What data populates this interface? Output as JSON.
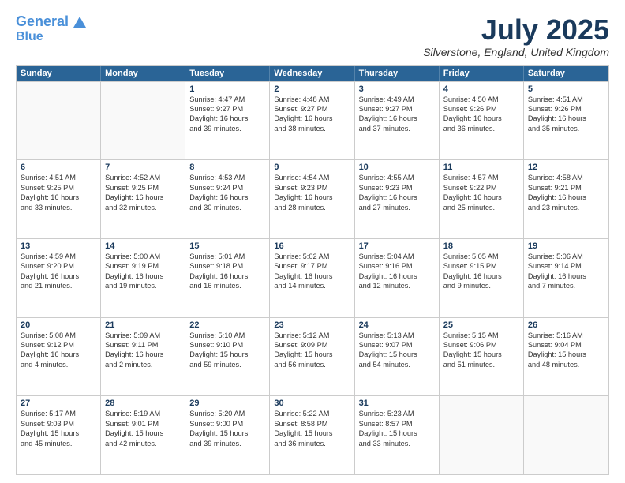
{
  "logo": {
    "line1": "General",
    "line2": "Blue"
  },
  "title": "July 2025",
  "location": "Silverstone, England, United Kingdom",
  "header_days": [
    "Sunday",
    "Monday",
    "Tuesday",
    "Wednesday",
    "Thursday",
    "Friday",
    "Saturday"
  ],
  "weeks": [
    [
      {
        "day": "",
        "sunrise": "",
        "sunset": "",
        "daylight": ""
      },
      {
        "day": "",
        "sunrise": "",
        "sunset": "",
        "daylight": ""
      },
      {
        "day": "1",
        "sunrise": "Sunrise: 4:47 AM",
        "sunset": "Sunset: 9:27 PM",
        "daylight": "Daylight: 16 hours and 39 minutes."
      },
      {
        "day": "2",
        "sunrise": "Sunrise: 4:48 AM",
        "sunset": "Sunset: 9:27 PM",
        "daylight": "Daylight: 16 hours and 38 minutes."
      },
      {
        "day": "3",
        "sunrise": "Sunrise: 4:49 AM",
        "sunset": "Sunset: 9:27 PM",
        "daylight": "Daylight: 16 hours and 37 minutes."
      },
      {
        "day": "4",
        "sunrise": "Sunrise: 4:50 AM",
        "sunset": "Sunset: 9:26 PM",
        "daylight": "Daylight: 16 hours and 36 minutes."
      },
      {
        "day": "5",
        "sunrise": "Sunrise: 4:51 AM",
        "sunset": "Sunset: 9:26 PM",
        "daylight": "Daylight: 16 hours and 35 minutes."
      }
    ],
    [
      {
        "day": "6",
        "sunrise": "Sunrise: 4:51 AM",
        "sunset": "Sunset: 9:25 PM",
        "daylight": "Daylight: 16 hours and 33 minutes."
      },
      {
        "day": "7",
        "sunrise": "Sunrise: 4:52 AM",
        "sunset": "Sunset: 9:25 PM",
        "daylight": "Daylight: 16 hours and 32 minutes."
      },
      {
        "day": "8",
        "sunrise": "Sunrise: 4:53 AM",
        "sunset": "Sunset: 9:24 PM",
        "daylight": "Daylight: 16 hours and 30 minutes."
      },
      {
        "day": "9",
        "sunrise": "Sunrise: 4:54 AM",
        "sunset": "Sunset: 9:23 PM",
        "daylight": "Daylight: 16 hours and 28 minutes."
      },
      {
        "day": "10",
        "sunrise": "Sunrise: 4:55 AM",
        "sunset": "Sunset: 9:23 PM",
        "daylight": "Daylight: 16 hours and 27 minutes."
      },
      {
        "day": "11",
        "sunrise": "Sunrise: 4:57 AM",
        "sunset": "Sunset: 9:22 PM",
        "daylight": "Daylight: 16 hours and 25 minutes."
      },
      {
        "day": "12",
        "sunrise": "Sunrise: 4:58 AM",
        "sunset": "Sunset: 9:21 PM",
        "daylight": "Daylight: 16 hours and 23 minutes."
      }
    ],
    [
      {
        "day": "13",
        "sunrise": "Sunrise: 4:59 AM",
        "sunset": "Sunset: 9:20 PM",
        "daylight": "Daylight: 16 hours and 21 minutes."
      },
      {
        "day": "14",
        "sunrise": "Sunrise: 5:00 AM",
        "sunset": "Sunset: 9:19 PM",
        "daylight": "Daylight: 16 hours and 19 minutes."
      },
      {
        "day": "15",
        "sunrise": "Sunrise: 5:01 AM",
        "sunset": "Sunset: 9:18 PM",
        "daylight": "Daylight: 16 hours and 16 minutes."
      },
      {
        "day": "16",
        "sunrise": "Sunrise: 5:02 AM",
        "sunset": "Sunset: 9:17 PM",
        "daylight": "Daylight: 16 hours and 14 minutes."
      },
      {
        "day": "17",
        "sunrise": "Sunrise: 5:04 AM",
        "sunset": "Sunset: 9:16 PM",
        "daylight": "Daylight: 16 hours and 12 minutes."
      },
      {
        "day": "18",
        "sunrise": "Sunrise: 5:05 AM",
        "sunset": "Sunset: 9:15 PM",
        "daylight": "Daylight: 16 hours and 9 minutes."
      },
      {
        "day": "19",
        "sunrise": "Sunrise: 5:06 AM",
        "sunset": "Sunset: 9:14 PM",
        "daylight": "Daylight: 16 hours and 7 minutes."
      }
    ],
    [
      {
        "day": "20",
        "sunrise": "Sunrise: 5:08 AM",
        "sunset": "Sunset: 9:12 PM",
        "daylight": "Daylight: 16 hours and 4 minutes."
      },
      {
        "day": "21",
        "sunrise": "Sunrise: 5:09 AM",
        "sunset": "Sunset: 9:11 PM",
        "daylight": "Daylight: 16 hours and 2 minutes."
      },
      {
        "day": "22",
        "sunrise": "Sunrise: 5:10 AM",
        "sunset": "Sunset: 9:10 PM",
        "daylight": "Daylight: 15 hours and 59 minutes."
      },
      {
        "day": "23",
        "sunrise": "Sunrise: 5:12 AM",
        "sunset": "Sunset: 9:09 PM",
        "daylight": "Daylight: 15 hours and 56 minutes."
      },
      {
        "day": "24",
        "sunrise": "Sunrise: 5:13 AM",
        "sunset": "Sunset: 9:07 PM",
        "daylight": "Daylight: 15 hours and 54 minutes."
      },
      {
        "day": "25",
        "sunrise": "Sunrise: 5:15 AM",
        "sunset": "Sunset: 9:06 PM",
        "daylight": "Daylight: 15 hours and 51 minutes."
      },
      {
        "day": "26",
        "sunrise": "Sunrise: 5:16 AM",
        "sunset": "Sunset: 9:04 PM",
        "daylight": "Daylight: 15 hours and 48 minutes."
      }
    ],
    [
      {
        "day": "27",
        "sunrise": "Sunrise: 5:17 AM",
        "sunset": "Sunset: 9:03 PM",
        "daylight": "Daylight: 15 hours and 45 minutes."
      },
      {
        "day": "28",
        "sunrise": "Sunrise: 5:19 AM",
        "sunset": "Sunset: 9:01 PM",
        "daylight": "Daylight: 15 hours and 42 minutes."
      },
      {
        "day": "29",
        "sunrise": "Sunrise: 5:20 AM",
        "sunset": "Sunset: 9:00 PM",
        "daylight": "Daylight: 15 hours and 39 minutes."
      },
      {
        "day": "30",
        "sunrise": "Sunrise: 5:22 AM",
        "sunset": "Sunset: 8:58 PM",
        "daylight": "Daylight: 15 hours and 36 minutes."
      },
      {
        "day": "31",
        "sunrise": "Sunrise: 5:23 AM",
        "sunset": "Sunset: 8:57 PM",
        "daylight": "Daylight: 15 hours and 33 minutes."
      },
      {
        "day": "",
        "sunrise": "",
        "sunset": "",
        "daylight": ""
      },
      {
        "day": "",
        "sunrise": "",
        "sunset": "",
        "daylight": ""
      }
    ]
  ]
}
